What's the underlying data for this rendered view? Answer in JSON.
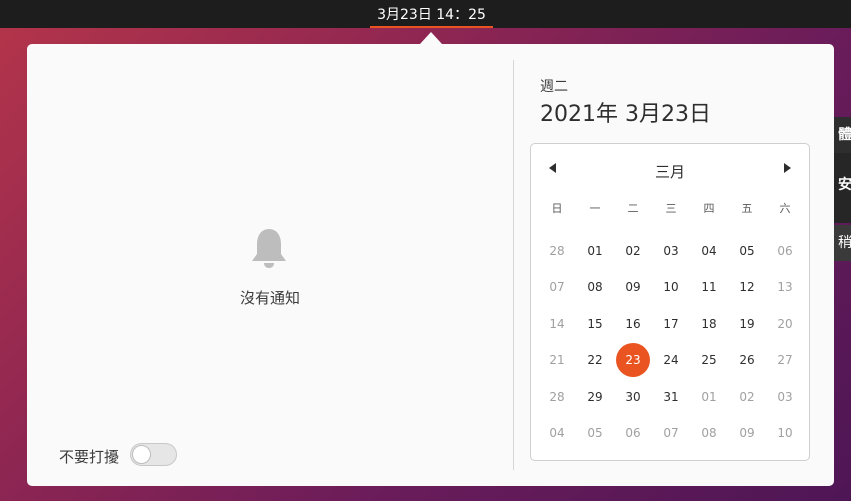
{
  "topbar": {
    "clock": "3月23日  14：25"
  },
  "side_window": {
    "line1": "體更",
    "line2": "安裝",
    "line3": "稍"
  },
  "notifications": {
    "empty_text": "沒有通知"
  },
  "dnd": {
    "label": "不要打擾",
    "enabled": false
  },
  "date_header": {
    "weekday": "週二",
    "date": "2021年 3月23日"
  },
  "calendar": {
    "month": "三月",
    "weekdays": [
      "日",
      "一",
      "二",
      "三",
      "四",
      "五",
      "六"
    ],
    "weeks": [
      [
        "28",
        "01",
        "02",
        "03",
        "04",
        "05",
        "06"
      ],
      [
        "07",
        "08",
        "09",
        "10",
        "11",
        "12",
        "13"
      ],
      [
        "14",
        "15",
        "16",
        "17",
        "18",
        "19",
        "20"
      ],
      [
        "21",
        "22",
        "23",
        "24",
        "25",
        "26",
        "27"
      ],
      [
        "28",
        "29",
        "30",
        "31",
        "01",
        "02",
        "03"
      ],
      [
        "04",
        "05",
        "06",
        "07",
        "08",
        "09",
        "10"
      ]
    ],
    "dim": [
      [
        true,
        false,
        false,
        false,
        false,
        false,
        true
      ],
      [
        true,
        false,
        false,
        false,
        false,
        false,
        true
      ],
      [
        true,
        false,
        false,
        false,
        false,
        false,
        true
      ],
      [
        true,
        false,
        false,
        false,
        false,
        false,
        true
      ],
      [
        true,
        false,
        false,
        false,
        true,
        true,
        true
      ],
      [
        true,
        true,
        true,
        true,
        true,
        true,
        true
      ]
    ],
    "today": [
      3,
      2
    ]
  },
  "colors": {
    "accent": "#e95420",
    "topbar": "#1d1d1d",
    "popup": "#fafafa"
  }
}
